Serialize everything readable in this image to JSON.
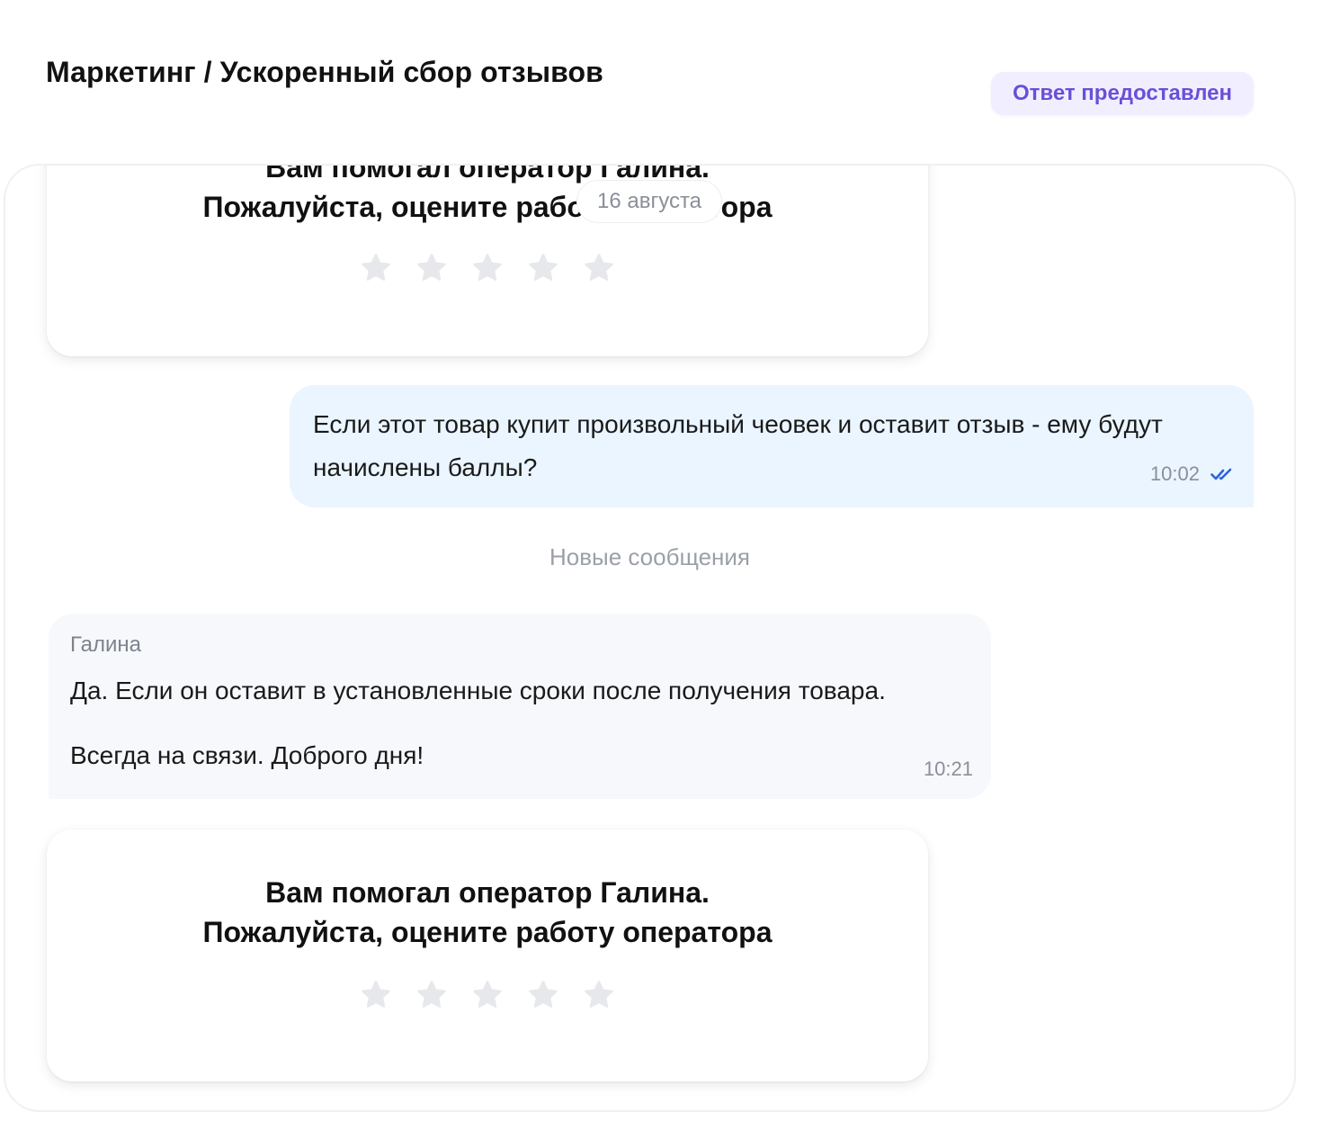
{
  "header": {
    "breadcrumb": "Маркетинг / Ускоренный сбор отзывов",
    "status_badge": "Ответ предоставлен"
  },
  "chat": {
    "date_separator": "16 августа",
    "rating_card_top": {
      "line1": "Вам помогал оператор Галина.",
      "line2": "Пожалуйста, оцените работу оператора"
    },
    "outgoing_message": {
      "text": "Если этот товар купит произвольный чеовек и оставит отзыв - ему будут начислены баллы?",
      "time": "10:02",
      "status_icon": "double-check-icon"
    },
    "new_messages_label": "Новые сообщения",
    "incoming_message": {
      "sender": "Галина",
      "line1": "Да. Если он оставит в установленные сроки после получения товара.",
      "line2": "Всегда на связи. Доброго дня!",
      "time": "10:21"
    },
    "rating_card_bottom": {
      "line1": "Вам помогал оператор Галина.",
      "line2": "Пожалуйста, оцените работу оператора"
    },
    "star_count": 5
  },
  "colors": {
    "badge_bg": "#f1efff",
    "badge_text": "#6a4fd8",
    "outgoing_bg": "#eaf5ff",
    "incoming_bg": "#f6f8fc",
    "star": "#e6e8ec",
    "check": "#2f62d8"
  }
}
